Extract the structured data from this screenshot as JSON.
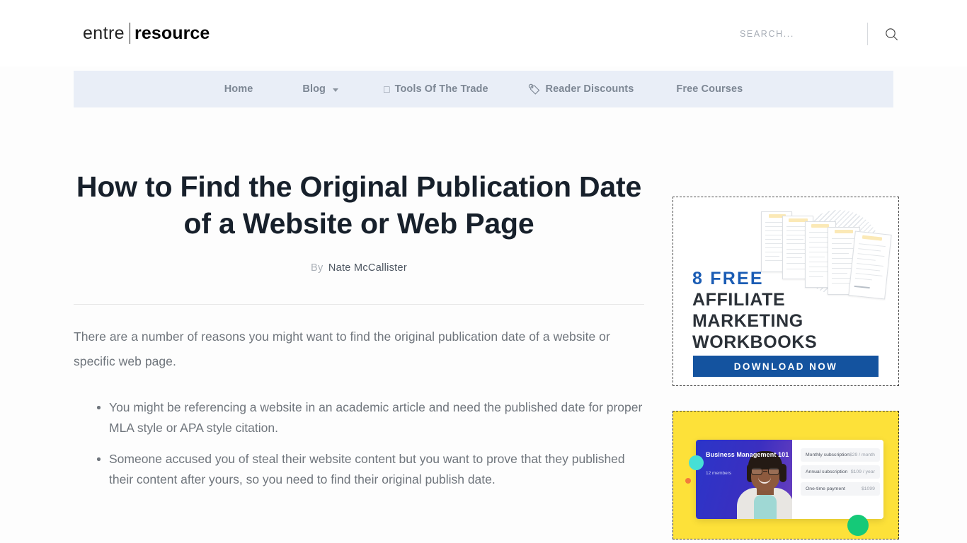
{
  "header": {
    "logo": {
      "first": "entre",
      "second": "resource"
    },
    "search": {
      "placeholder": "SEARCH...",
      "value": "",
      "icon": "search-icon"
    }
  },
  "nav": {
    "items": [
      {
        "label": "Home",
        "emoji": "",
        "has_caret": false
      },
      {
        "label": "Blog",
        "emoji": "",
        "has_caret": true
      },
      {
        "label": "Tools Of The Trade",
        "emoji": "□",
        "has_caret": false
      },
      {
        "label": "Reader Discounts",
        "emoji": "🏷",
        "has_caret": false
      },
      {
        "label": "Free Courses",
        "emoji": "",
        "has_caret": false
      }
    ]
  },
  "article": {
    "title": "How to Find the Original Publication Date of a Website or Web Page",
    "byline_prefix": "By",
    "author": "Nate McCallister",
    "intro": "There are a number of reasons you might want to find the original publication date of a website or specific web page.",
    "bullets": [
      "You might be referencing a website in an academic article and need the published date for proper MLA style or APA style citation.",
      "Someone accused you of steal their website content but you want to prove that they published their content after yours, so you need to find their original publish date."
    ]
  },
  "sidebar": {
    "ad_workbooks": {
      "line1": "8 FREE",
      "line2": "AFFILIATE",
      "line3": "MARKETING",
      "line4": "WORKBOOKS",
      "cta": "DOWNLOAD NOW",
      "accent_blue": "#1a5cb4",
      "cta_bg": "#14539f"
    },
    "ad_course": {
      "bg_color": "#fde139",
      "course_title": "Business Management 101",
      "members": "12 members",
      "pricing": [
        {
          "label": "Monthly subscription",
          "value": "$29 / month"
        },
        {
          "label": "Annual subscription",
          "value": "$109 / year"
        },
        {
          "label": "One-time payment",
          "value": "$1099"
        }
      ]
    }
  }
}
